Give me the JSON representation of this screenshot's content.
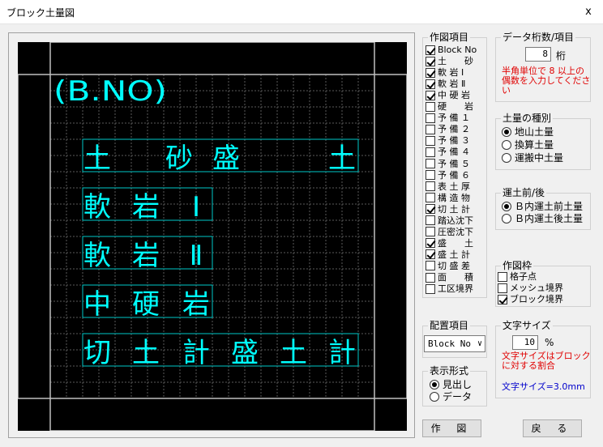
{
  "window": {
    "title": "ブロック土量図",
    "close": "x"
  },
  "canvas": {
    "labels": [
      "(B.NO)",
      "土",
      "砂盛",
      "土",
      "軟",
      "岩",
      "Ⅰ",
      "軟",
      "岩",
      "Ⅱ",
      "中",
      "硬",
      "岩",
      "切",
      "土",
      "計",
      "盛",
      "土",
      "計"
    ],
    "colors": {
      "background": "#000000",
      "grid": "#5a5a5a",
      "border": "#c0c0c0",
      "label": "#00ffff",
      "box": "#00c8c8"
    }
  },
  "draw_items": {
    "title": "作図項目",
    "items": [
      {
        "label": "Block No",
        "checked": true
      },
      {
        "label": "土　　砂",
        "checked": true
      },
      {
        "label": "軟 岩 Ⅰ",
        "checked": true
      },
      {
        "label": "軟 岩 Ⅱ",
        "checked": true
      },
      {
        "label": "中 硬 岩",
        "checked": true
      },
      {
        "label": "硬　　岩",
        "checked": false
      },
      {
        "label": "予 備 １",
        "checked": false
      },
      {
        "label": "予 備 ２",
        "checked": false
      },
      {
        "label": "予 備 ３",
        "checked": false
      },
      {
        "label": "予 備 ４",
        "checked": false
      },
      {
        "label": "予 備 ５",
        "checked": false
      },
      {
        "label": "予 備 ６",
        "checked": false
      },
      {
        "label": "表 土 厚",
        "checked": false
      },
      {
        "label": "構 造 物",
        "checked": false
      },
      {
        "label": "切 土 計",
        "checked": true
      },
      {
        "label": "踏込沈下",
        "checked": false
      },
      {
        "label": "圧密沈下",
        "checked": false
      },
      {
        "label": "盛　　土",
        "checked": true
      },
      {
        "label": "盛 土 計",
        "checked": true
      },
      {
        "label": "切 盛 差",
        "checked": false
      },
      {
        "label": "面　　積",
        "checked": false
      },
      {
        "label": "工区境界",
        "checked": false
      }
    ]
  },
  "digits": {
    "title": "データ桁数/項目",
    "value": "8",
    "unit": "桁",
    "note": "半角単位で 8 以上の偶数を入力してください"
  },
  "soil_type": {
    "title": "土量の種別",
    "options": [
      {
        "label": "地山土量",
        "selected": true
      },
      {
        "label": "換算土量",
        "selected": false
      },
      {
        "label": "運搬中土量",
        "selected": false
      }
    ]
  },
  "transport": {
    "title": "運土前/後",
    "options": [
      {
        "label": "Ｂ内運土前土量",
        "selected": true
      },
      {
        "label": "Ｂ内運土後土量",
        "selected": false
      }
    ]
  },
  "frame": {
    "title": "作図枠",
    "items": [
      {
        "label": "格子点",
        "checked": false
      },
      {
        "label": "メッシュ境界",
        "checked": false
      },
      {
        "label": "ブロック境界",
        "checked": true
      }
    ]
  },
  "placement": {
    "title": "配置項目",
    "selected": "Block No",
    "arrow": "∨"
  },
  "font_size": {
    "title": "文字サイズ",
    "value": "10",
    "unit": "%",
    "note": "文字サイズはブロックに対する割合",
    "computed": "文字サイズ=3.0mm"
  },
  "display": {
    "title": "表示形式",
    "options": [
      {
        "label": "見出し",
        "selected": true
      },
      {
        "label": "データ",
        "selected": false
      }
    ]
  },
  "buttons": {
    "draw": "作 図",
    "back": "戻 る"
  }
}
